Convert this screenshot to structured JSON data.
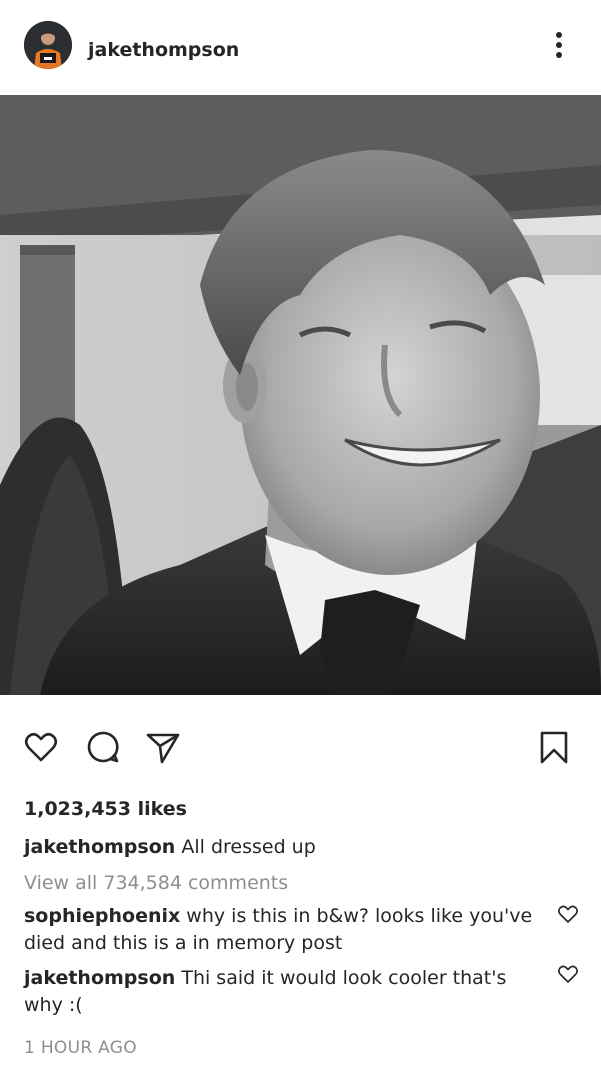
{
  "post": {
    "username": "jakethompson",
    "likes_text": "1,023,453 likes",
    "caption": {
      "username": "jakethompson",
      "text": "All dressed up"
    },
    "view_all_comments": "View all 734,584 comments",
    "comments": [
      {
        "username": "sophiephoenix",
        "text": "why is this in b&w? looks like you've died and this is a in memory post"
      },
      {
        "username": "jakethompson",
        "text": "Thi said it would look cooler that's why :("
      }
    ],
    "timestamp": "1 HOUR AGO"
  },
  "icons": {
    "more": "more-vertical-icon",
    "like": "heart-icon",
    "comment": "comment-bubble-icon",
    "share": "paper-plane-icon",
    "save": "bookmark-icon",
    "comment_like": "heart-small-icon"
  },
  "colors": {
    "text": "#262626",
    "muted": "#8e8e8e",
    "background": "#ffffff"
  }
}
